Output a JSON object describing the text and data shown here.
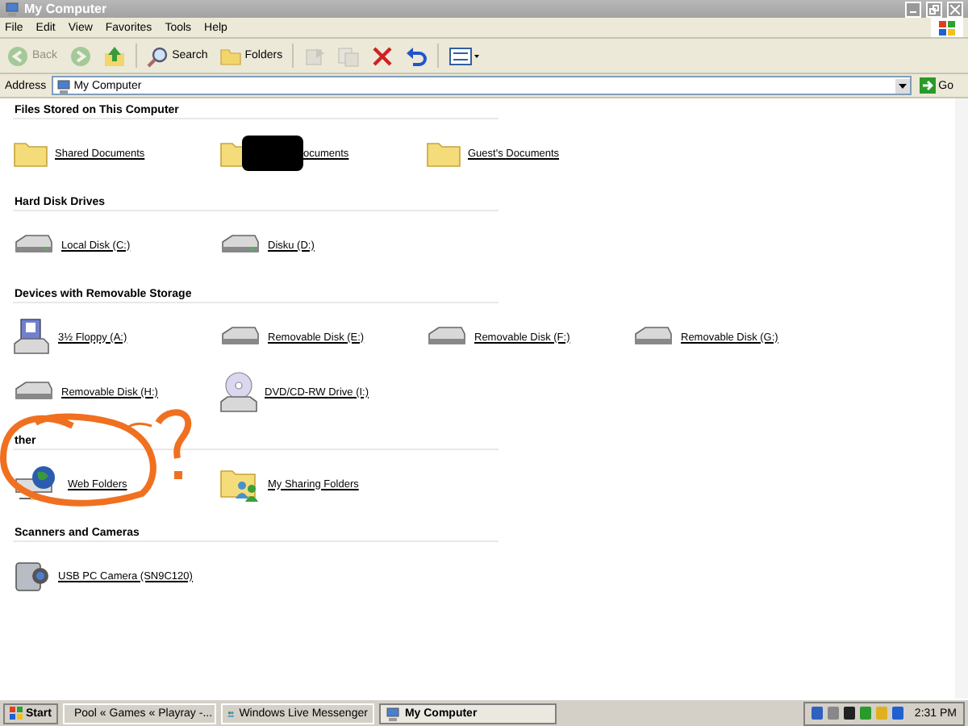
{
  "window": {
    "title": "My Computer"
  },
  "menu": [
    "File",
    "Edit",
    "View",
    "Favorites",
    "Tools",
    "Help"
  ],
  "toolbar": [
    {
      "kind": "back",
      "label": "Back",
      "disabled": true
    },
    {
      "kind": "forward",
      "disabled": true
    },
    {
      "kind": "up",
      "disabled": false
    },
    {
      "kind": "search",
      "label": "Search",
      "disabled": false
    },
    {
      "kind": "folders",
      "label": "Folders",
      "disabled": false
    },
    {
      "kind": "move",
      "disabled": true
    },
    {
      "kind": "copy",
      "disabled": true
    },
    {
      "kind": "delete",
      "disabled": false
    },
    {
      "kind": "undo",
      "disabled": false
    },
    {
      "kind": "views",
      "disabled": false
    }
  ],
  "address": {
    "label": "Address",
    "value": "My Computer",
    "go": "Go"
  },
  "groups": [
    {
      "title": "Files Stored on This Computer",
      "items": [
        {
          "kind": "folder",
          "label": "Shared Documents"
        },
        {
          "kind": "folder",
          "label": "ocuments",
          "redacted": true
        },
        {
          "kind": "folder",
          "label": "Guest's Documents"
        }
      ]
    },
    {
      "title": "Hard Disk Drives",
      "items": [
        {
          "kind": "disk",
          "label": "Local Disk (C:)"
        },
        {
          "kind": "disk",
          "label": "Disku (D:)"
        }
      ]
    },
    {
      "title": "Devices with Removable Storage",
      "items": [
        {
          "kind": "floppy",
          "label": "3½ Floppy (A:)"
        },
        {
          "kind": "removable",
          "label": "Removable Disk (E:)"
        },
        {
          "kind": "removable",
          "label": "Removable Disk (F:)"
        },
        {
          "kind": "removable",
          "label": "Removable Disk (G:)"
        },
        {
          "kind": "removable",
          "label": "Removable Disk (H:)"
        },
        {
          "kind": "dvd",
          "label": "DVD/CD-RW Drive (I:)"
        }
      ]
    },
    {
      "title": "ther",
      "circled": true,
      "items": [
        {
          "kind": "webfolder",
          "label": "Web Folders"
        },
        {
          "kind": "sharing",
          "label": "My Sharing Folders"
        }
      ]
    },
    {
      "title": "Scanners and Cameras",
      "items": [
        {
          "kind": "camera",
          "label": "USB PC Camera (SN9C120)"
        }
      ]
    }
  ],
  "taskbar": {
    "start": "Start",
    "buttons": [
      {
        "kind": "browser",
        "label": "Pool « Games « Playray -...",
        "selected": false
      },
      {
        "kind": "messenger",
        "label": "Windows Live Messenger",
        "selected": false
      },
      {
        "kind": "computer",
        "label": "My Computer",
        "selected": true
      }
    ],
    "clock": "2:31 PM"
  }
}
